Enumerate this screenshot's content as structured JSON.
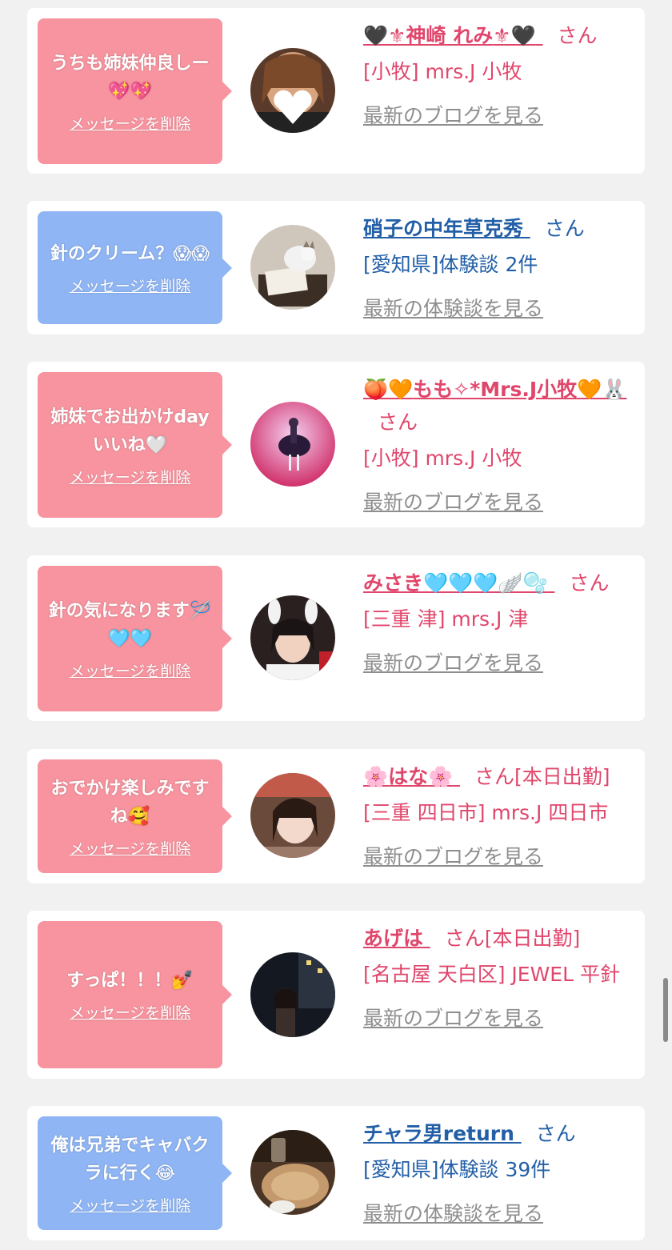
{
  "ui": {
    "delete_label": "メッセージを削除",
    "san": "さん",
    "latest_blog": "最新のブログを見る",
    "latest_report": "最新の体験談を見る"
  },
  "cards": [
    {
      "message": "うちも姉妹仲良しー",
      "message_emoji": "💖💖",
      "name_prefix": "🖤⚜",
      "name": "神崎 れみ",
      "name_suffix": "⚜🖤",
      "status": "",
      "place": "[小牧] mrs.J 小牧"
    },
    {
      "message": "針のクリーム？",
      "message_emoji": "😱😱",
      "name_prefix": "",
      "name": "硝子の中年草克秀",
      "name_suffix": "",
      "status": "",
      "place": "[愛知県]体験談 2件"
    },
    {
      "message": "姉妹でお出かけdayいいね",
      "message_emoji": "🤍",
      "name_prefix": "🍑🧡",
      "name": "もも✧*Mrs.J小牧",
      "name_suffix": "🧡🐰",
      "status": "",
      "place": "[小牧] mrs.J 小牧"
    },
    {
      "message": "針の気になります",
      "message_emoji": "🪡🩵🩵",
      "name_prefix": "",
      "name": "みさき",
      "name_suffix": "🩵🩵🩵🪽🫧",
      "status": "",
      "place": "[三重 津] mrs.J 津"
    },
    {
      "message": "おでかけ楽しみですね",
      "message_emoji": "🥰",
      "name_prefix": "🌸",
      "name": "はな",
      "name_suffix": "🌸",
      "status": "[本日出勤]",
      "place": "[三重 四日市] mrs.J 四日市"
    },
    {
      "message": "すっぱ！！！",
      "message_emoji": "💅",
      "name_prefix": "",
      "name": "あげは",
      "name_suffix": "",
      "status": "[本日出勤]",
      "place": "[名古屋 天白区] JEWEL 平針"
    },
    {
      "message": "俺は兄弟でキャバクラに行く",
      "message_emoji": "😂",
      "name_prefix": "",
      "name": "チャラ男return",
      "name_suffix": "",
      "status": "",
      "place": "[愛知県]体験談 39件"
    }
  ],
  "colors": {
    "pink_bubble": "#f7949f",
    "blue_bubble": "#8fb5f4",
    "pink_text": "#e0466b",
    "blue_text": "#225fa7",
    "link_gray": "#8e8e8e",
    "page_bg": "#f1f1f1"
  }
}
